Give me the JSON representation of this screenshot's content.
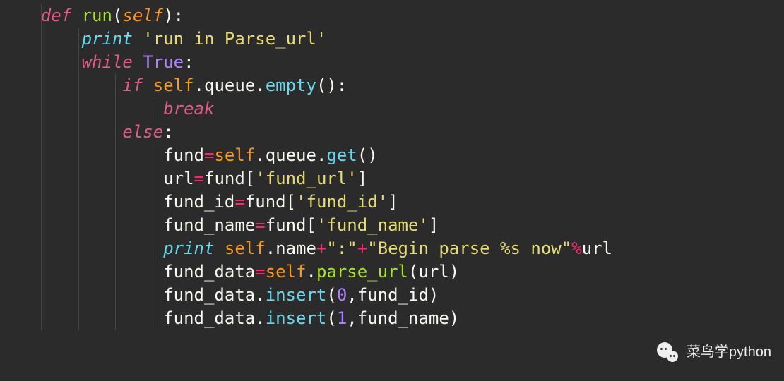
{
  "code": {
    "tokens": [
      [
        {
          "t": "ws",
          "v": "    "
        },
        {
          "t": "kw",
          "v": "def"
        },
        {
          "t": "ws",
          "v": " "
        },
        {
          "t": "fn",
          "v": "run"
        },
        {
          "t": "punct",
          "v": "("
        },
        {
          "t": "self",
          "v": "self"
        },
        {
          "t": "punct",
          "v": "):"
        }
      ],
      [
        {
          "t": "ws",
          "v": "        "
        },
        {
          "t": "kw-blue",
          "v": "print"
        },
        {
          "t": "ws",
          "v": " "
        },
        {
          "t": "str",
          "v": "'run in Parse_url'"
        }
      ],
      [
        {
          "t": "ws",
          "v": "        "
        },
        {
          "t": "kw",
          "v": "while"
        },
        {
          "t": "ws",
          "v": " "
        },
        {
          "t": "const",
          "v": "True"
        },
        {
          "t": "punct",
          "v": ":"
        }
      ],
      [
        {
          "t": "ws",
          "v": "            "
        },
        {
          "t": "kw",
          "v": "if"
        },
        {
          "t": "ws",
          "v": " "
        },
        {
          "t": "selfn",
          "v": "self"
        },
        {
          "t": "punct",
          "v": "."
        },
        {
          "t": "ident",
          "v": "queue"
        },
        {
          "t": "punct",
          "v": "."
        },
        {
          "t": "call",
          "v": "empty"
        },
        {
          "t": "punct",
          "v": "():"
        }
      ],
      [
        {
          "t": "ws",
          "v": "                "
        },
        {
          "t": "kw",
          "v": "break"
        }
      ],
      [
        {
          "t": "ws",
          "v": "            "
        },
        {
          "t": "kw",
          "v": "else"
        },
        {
          "t": "punct",
          "v": ":"
        }
      ],
      [
        {
          "t": "ws",
          "v": "                "
        },
        {
          "t": "ident",
          "v": "fund"
        },
        {
          "t": "op",
          "v": "="
        },
        {
          "t": "selfn",
          "v": "self"
        },
        {
          "t": "punct",
          "v": "."
        },
        {
          "t": "ident",
          "v": "queue"
        },
        {
          "t": "punct",
          "v": "."
        },
        {
          "t": "call",
          "v": "get"
        },
        {
          "t": "punct",
          "v": "()"
        }
      ],
      [
        {
          "t": "ws",
          "v": "                "
        },
        {
          "t": "ident",
          "v": "url"
        },
        {
          "t": "op",
          "v": "="
        },
        {
          "t": "ident",
          "v": "fund"
        },
        {
          "t": "punct",
          "v": "["
        },
        {
          "t": "str",
          "v": "'fund_url'"
        },
        {
          "t": "punct",
          "v": "]"
        }
      ],
      [
        {
          "t": "ws",
          "v": "                "
        },
        {
          "t": "ident",
          "v": "fund_id"
        },
        {
          "t": "op",
          "v": "="
        },
        {
          "t": "ident",
          "v": "fund"
        },
        {
          "t": "punct",
          "v": "["
        },
        {
          "t": "str",
          "v": "'fund_id'"
        },
        {
          "t": "punct",
          "v": "]"
        }
      ],
      [
        {
          "t": "ws",
          "v": "                "
        },
        {
          "t": "ident",
          "v": "fund_name"
        },
        {
          "t": "op",
          "v": "="
        },
        {
          "t": "ident",
          "v": "fund"
        },
        {
          "t": "punct",
          "v": "["
        },
        {
          "t": "str",
          "v": "'fund_name'"
        },
        {
          "t": "punct",
          "v": "]"
        }
      ],
      [
        {
          "t": "ws",
          "v": "                "
        },
        {
          "t": "kw-blue",
          "v": "print"
        },
        {
          "t": "ws",
          "v": " "
        },
        {
          "t": "selfn",
          "v": "self"
        },
        {
          "t": "punct",
          "v": "."
        },
        {
          "t": "ident",
          "v": "name"
        },
        {
          "t": "op",
          "v": "+"
        },
        {
          "t": "str",
          "v": "\":\""
        },
        {
          "t": "op",
          "v": "+"
        },
        {
          "t": "str",
          "v": "\"Begin parse %s now\""
        },
        {
          "t": "op",
          "v": "%"
        },
        {
          "t": "ident",
          "v": "url"
        }
      ],
      [
        {
          "t": "ws",
          "v": "                "
        },
        {
          "t": "ident",
          "v": "fund_data"
        },
        {
          "t": "op",
          "v": "="
        },
        {
          "t": "selfn",
          "v": "self"
        },
        {
          "t": "punct",
          "v": "."
        },
        {
          "t": "callg",
          "v": "parse_url"
        },
        {
          "t": "punct",
          "v": "("
        },
        {
          "t": "ident",
          "v": "url"
        },
        {
          "t": "punct",
          "v": ")"
        }
      ],
      [
        {
          "t": "ws",
          "v": "                "
        },
        {
          "t": "ident",
          "v": "fund_data"
        },
        {
          "t": "punct",
          "v": "."
        },
        {
          "t": "call",
          "v": "insert"
        },
        {
          "t": "punct",
          "v": "("
        },
        {
          "t": "num",
          "v": "0"
        },
        {
          "t": "punct",
          "v": ","
        },
        {
          "t": "ident",
          "v": "fund_id"
        },
        {
          "t": "punct",
          "v": ")"
        }
      ],
      [
        {
          "t": "ws",
          "v": "                "
        },
        {
          "t": "ident",
          "v": "fund_data"
        },
        {
          "t": "punct",
          "v": "."
        },
        {
          "t": "call",
          "v": "insert"
        },
        {
          "t": "punct",
          "v": "("
        },
        {
          "t": "num",
          "v": "1"
        },
        {
          "t": "punct",
          "v": ","
        },
        {
          "t": "ident",
          "v": "fund_name"
        },
        {
          "t": "punct",
          "v": ")"
        }
      ]
    ],
    "indent_guides": [
      [
        1
      ],
      [
        1,
        2
      ],
      [
        1,
        2
      ],
      [
        1,
        2,
        3
      ],
      [
        1,
        2,
        3,
        4
      ],
      [
        1,
        2,
        3
      ],
      [
        1,
        2,
        3,
        4
      ],
      [
        1,
        2,
        3,
        4
      ],
      [
        1,
        2,
        3,
        4
      ],
      [
        1,
        2,
        3,
        4
      ],
      [
        1,
        2,
        3,
        4
      ],
      [
        1,
        2,
        3,
        4
      ],
      [
        1,
        2,
        3,
        4
      ],
      [
        1,
        2,
        3,
        4
      ]
    ]
  },
  "watermark": {
    "label": "菜鸟学python"
  }
}
